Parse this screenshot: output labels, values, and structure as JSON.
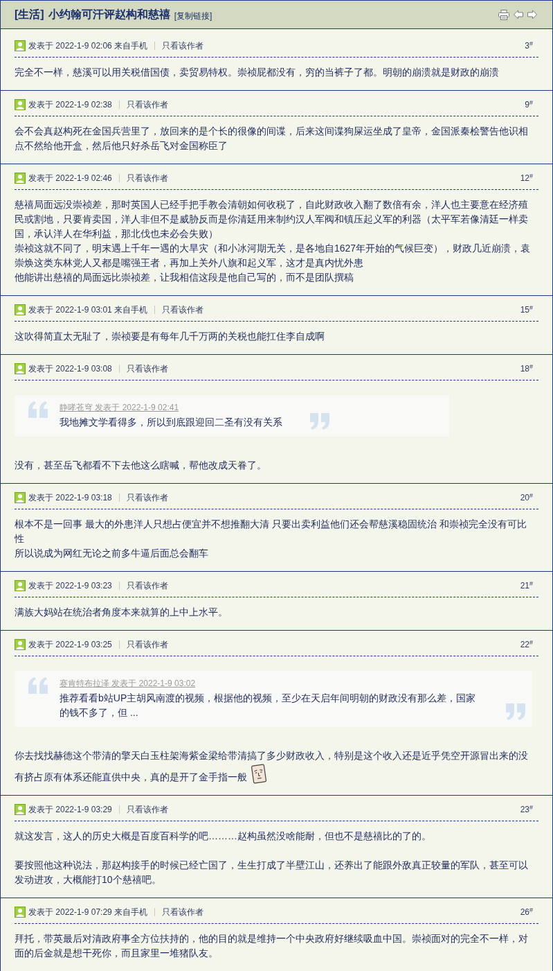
{
  "thread": {
    "category": "[生活]",
    "title": "小约翰可汗评赵构和慈禧",
    "copy_link": "[复制链接]"
  },
  "posts": [
    {
      "posted": "发表于 2022-1-9 02:06 来自手机",
      "author_only": "只看该作者",
      "floor": "3$^{#}$",
      "blocks": [
        {
          "kind": "text",
          "lines": [
            "完全不一样，慈溪可以用关税借国债，卖贸易特权。崇祯屁都没有，穷的当裤子了都。明朝的崩溃就是财政的崩溃"
          ]
        }
      ]
    },
    {
      "posted": "发表于 2022-1-9 02:38",
      "author_only": "只看该作者",
      "floor": "9$^{#}$",
      "blocks": [
        {
          "kind": "text",
          "lines": [
            "会不会真赵构死在金国兵营里了，放回来的是个长的很像的间谍，后来这间谍狗屎运坐成了皇帝，金国派秦桧警告他识相点不然给他开盒，然后他只好杀岳飞对金国称臣了"
          ]
        }
      ]
    },
    {
      "posted": "发表于 2022-1-9 02:46",
      "author_only": "只看该作者",
      "floor": "12$^{#}$",
      "blocks": [
        {
          "kind": "text",
          "lines": [
            "慈禧局面远没崇祯差，那时英国人已经手把手教会清朝如何收税了，自此财政收入翻了数倍有余，洋人也主要意在经济殖民或割地，只要肯卖国，洋人非但不是威胁反而是你清廷用来制约汉人军阀和镇压起义军的利器（太平军若像清廷一样卖国，承认洋人在华利益，那北伐也未必会失败）",
            "崇祯这就不同了，明末遇上千年一遇的大旱灾（和小冰河期无关，是各地自1627年开始的气候巨变），财政几近崩溃，袁崇焕这类东林党人又都是嘴强王者，再加上关外八旗和起义军，这才是真内忧外患",
            "他能讲出慈禧的局面远比崇祯差，让我相信这段是他自己写的，而不是团队撰稿"
          ]
        }
      ]
    },
    {
      "posted": "发表于 2022-1-9 03:01 来自手机",
      "author_only": "只看该作者",
      "floor": "15$^{#}$",
      "blocks": [
        {
          "kind": "text",
          "lines": [
            "这吹得简直太无耻了，崇祯要是有每年几千万两的关税也能扛住李自成啊"
          ]
        }
      ]
    },
    {
      "posted": "发表于 2022-1-9 03:08",
      "author_only": "只看该作者",
      "floor": "18$^{#}$",
      "blocks": [
        {
          "kind": "quote",
          "author_line": "静哮苍穹 发表于 2022-1-9 02:41",
          "lines": [
            "我地摊文学看得多，所以到底跟迎回二圣有没有关系"
          ]
        },
        {
          "kind": "text",
          "lines": [
            "没有，甚至岳飞都看不下去他这么瞎喊，帮他改成天眷了。"
          ]
        }
      ]
    },
    {
      "posted": "发表于 2022-1-9 03:18",
      "author_only": "只看该作者",
      "floor": "20$^{#}$",
      "blocks": [
        {
          "kind": "text",
          "lines": [
            "根本不是一回事 最大的外患洋人只想占便宜并不想推翻大清 只要出卖利益他们还会帮慈溪稳固统治 和崇祯完全没有可比性",
            "所以说成为网红无论之前多牛逼后面总会翻车"
          ]
        }
      ]
    },
    {
      "posted": "发表于 2022-1-9 03:23",
      "author_only": "只看该作者",
      "floor": "21$^{#}$",
      "blocks": [
        {
          "kind": "text",
          "lines": [
            "满族大妈站在统治者角度本来就算的上中上水平。"
          ]
        }
      ]
    },
    {
      "posted": "发表于 2022-1-9 03:25",
      "author_only": "只看该作者",
      "floor": "22$^{#}$",
      "blocks": [
        {
          "kind": "quote",
          "author_line": "赛肯特布拉泽 发表于 2022-1-9 03:02",
          "lines": [
            "推荐看看b站UP主胡风南渡的视频，根据他的视频，至少在天启年间明朝的财政没有那么差，国家的钱不多了，但 ..."
          ]
        },
        {
          "kind": "text",
          "trailing_emoticon": true,
          "lines": [
            "你去找找赫德这个带清的擎天白玉柱架海紫金梁给带清搞了多少财政收入，特别是这个收入还是近乎凭空开源冒出来的没",
            "有挤占原有体系还能直供中央，真的是开了金手指一般"
          ]
        }
      ]
    },
    {
      "posted": "发表于 2022-1-9 03:29",
      "author_only": "只看该作者",
      "floor": "23$^{#}$",
      "blocks": [
        {
          "kind": "text",
          "lines": [
            "就这发言，这人的历史大概是百度百科学的吧………赵构虽然没啥能耐，但也不是慈禧比的了的。"
          ]
        },
        {
          "kind": "text",
          "lines": [
            "要按照他这种说法，那赵构接手的时候已经亡国了，生生打成了半壁江山，还养出了能跟外敌真正较量的军队，甚至可以发动进攻，大概能打10个慈禧吧。"
          ]
        }
      ]
    },
    {
      "posted": "发表于 2022-1-9 07:29 来自手机",
      "author_only": "只看该作者",
      "floor": "26$^{#}$",
      "blocks": [
        {
          "kind": "text",
          "lines": [
            "拜托，带英最后对清政府事全方位扶持的，他的目的就是维持一个中央政府好继续吸血中国。崇祯面对的完全不一样，对面的后金就是想干死你，而且家里一堆猪队友。"
          ]
        }
      ]
    }
  ]
}
